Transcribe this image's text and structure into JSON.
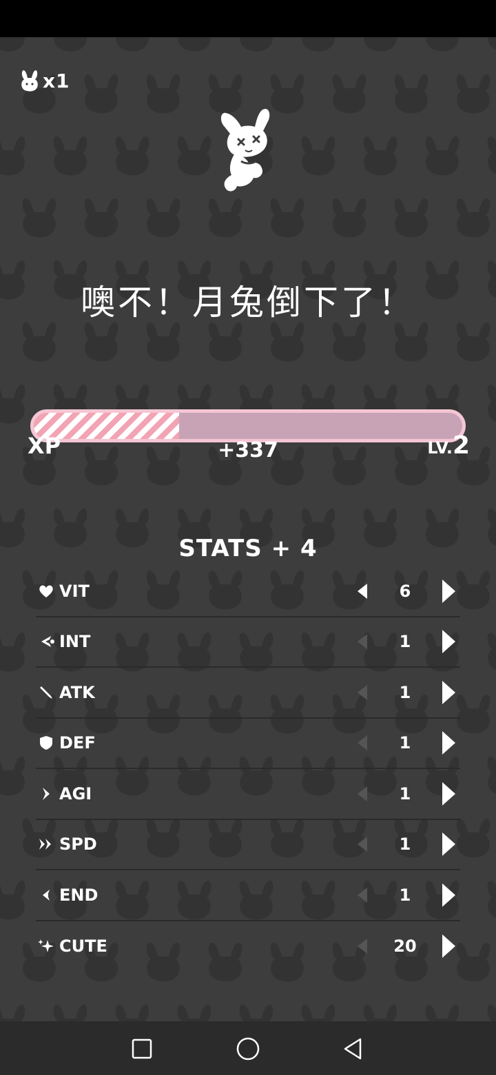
{
  "lives": {
    "multiplier": "x1",
    "icon": "bunny-icon"
  },
  "hero": {
    "icon": "fallen-bunny-icon"
  },
  "headline": "噢不！月兔倒下了！",
  "xp": {
    "label": "XP",
    "gain": "+337",
    "level_prefix": "LV.",
    "level": "2",
    "progress_fraction": 0.34,
    "fill_color": "#f2a3b4",
    "track_color": "#c8a3b6",
    "border_color": "#f4c6d4"
  },
  "stats": {
    "title": "STATS + 4",
    "items": [
      {
        "icon": "heart-icon",
        "name": "VIT",
        "value": "6",
        "dec_enabled": true
      },
      {
        "icon": "brain-icon",
        "name": "INT",
        "value": "1",
        "dec_enabled": false
      },
      {
        "icon": "sword-icon",
        "name": "ATK",
        "value": "1",
        "dec_enabled": false
      },
      {
        "icon": "shield-icon",
        "name": "DEF",
        "value": "1",
        "dec_enabled": false
      },
      {
        "icon": "chevron-icon",
        "name": "AGI",
        "value": "1",
        "dec_enabled": false
      },
      {
        "icon": "double-chevron-icon",
        "name": "SPD",
        "value": "1",
        "dec_enabled": false
      },
      {
        "icon": "endurance-icon",
        "name": "END",
        "value": "1",
        "dec_enabled": false
      },
      {
        "icon": "sparkle-icon",
        "name": "CUTE",
        "value": "20",
        "dec_enabled": false
      }
    ]
  },
  "nav": {
    "recents": "square-icon",
    "home": "circle-icon",
    "back": "triangle-back-icon"
  },
  "colors": {
    "background": "#3d3d3d",
    "pattern": "#333333",
    "text": "#ffffff",
    "disabled_arrow": "#555555"
  }
}
